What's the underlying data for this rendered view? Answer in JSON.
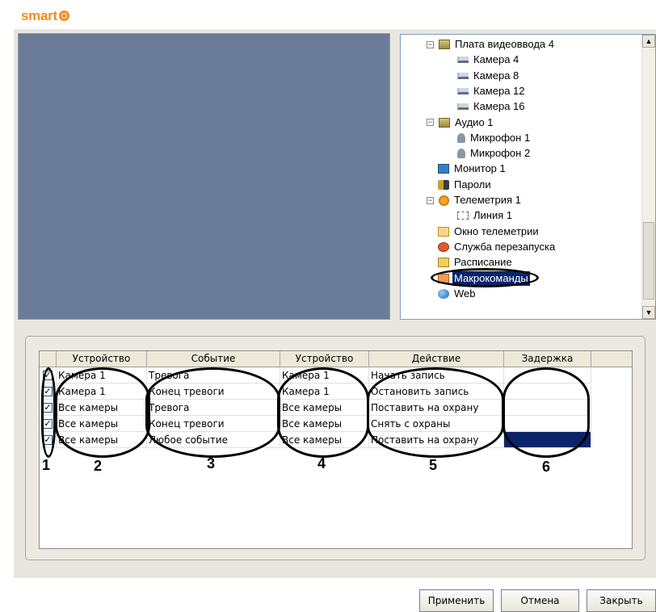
{
  "logo": {
    "text": "smart"
  },
  "tree": {
    "items": [
      {
        "label": "Плата видеоввода 4",
        "icon": "board-icon",
        "level": 0,
        "expander": "minus"
      },
      {
        "label": "Камера 4",
        "icon": "camera-icon",
        "level": 1
      },
      {
        "label": "Камера 8",
        "icon": "camera-icon",
        "level": 1
      },
      {
        "label": "Камера 12",
        "icon": "camera-icon",
        "level": 1
      },
      {
        "label": "Камера 16",
        "icon": "camera-icon",
        "level": 1
      },
      {
        "label": "Аудио 1",
        "icon": "board-icon",
        "level": 0,
        "expander": "minus"
      },
      {
        "label": "Микрофон 1",
        "icon": "microphone-icon",
        "level": 1
      },
      {
        "label": "Микрофон 2",
        "icon": "microphone-icon",
        "level": 1
      },
      {
        "label": "Монитор 1",
        "icon": "monitor-icon",
        "level": 0
      },
      {
        "label": "Пароли",
        "icon": "users-icon",
        "level": 0
      },
      {
        "label": "Телеметрия 1",
        "icon": "telemetry-icon",
        "level": 0,
        "expander": "minus"
      },
      {
        "label": "Линия 1",
        "icon": "line-icon",
        "level": 1
      },
      {
        "label": "Окно телеметрии",
        "icon": "window-icon",
        "level": 0
      },
      {
        "label": "Служба перезапуска",
        "icon": "restart-icon",
        "level": 0
      },
      {
        "label": "Расписание",
        "icon": "schedule-icon",
        "level": 0
      },
      {
        "label": "Макрокоманды",
        "icon": "macro-icon",
        "level": 0,
        "selected": true
      },
      {
        "label": "Web",
        "icon": "web-icon",
        "level": 0
      }
    ]
  },
  "grid": {
    "headers": [
      "Устройство",
      "Событие",
      "Устройство",
      "Действие",
      "Задержка"
    ],
    "rows": [
      {
        "checked": true,
        "device": "Камера 1",
        "event": "Тревога",
        "target": "Камера 1",
        "action": "Начать запись",
        "delay": ""
      },
      {
        "checked": true,
        "device": "Камера 1",
        "event": "Конец тревоги",
        "target": "Камера 1",
        "action": "Остановить запись",
        "delay": ""
      },
      {
        "checked": true,
        "device": "Все камеры",
        "event": "Тревога",
        "target": "Все камеры",
        "action": "Поставить на охрану",
        "delay": ""
      },
      {
        "checked": true,
        "device": "Все камеры",
        "event": "Конец тревоги",
        "target": "Все камеры",
        "action": "Снять с охраны",
        "delay": ""
      },
      {
        "checked": true,
        "device": "Все камеры",
        "event": "Любое событие",
        "target": "Все камеры",
        "action": "Поставить на охрану",
        "delay": "",
        "delay_selected": true
      }
    ]
  },
  "annotations": [
    "1",
    "2",
    "3",
    "4",
    "5",
    "6"
  ],
  "buttons": {
    "apply": "Применить",
    "cancel": "Отмена",
    "close": "Закрыть"
  },
  "colors": {
    "accent_logo": "#f28c1c",
    "selection": "#0a246a",
    "video_bg": "#6b7c98"
  }
}
